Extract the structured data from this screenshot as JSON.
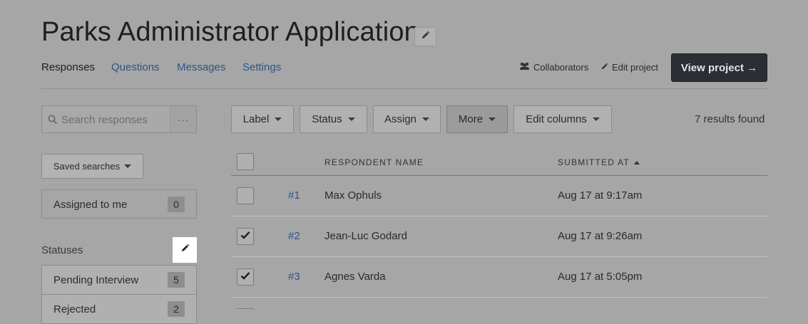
{
  "header": {
    "title": "Parks Administrator Application",
    "tabs": [
      {
        "label": "Responses",
        "active": true
      },
      {
        "label": "Questions",
        "active": false
      },
      {
        "label": "Messages",
        "active": false
      },
      {
        "label": "Settings",
        "active": false
      }
    ],
    "collaborators_label": "Collaborators",
    "edit_project_label": "Edit project",
    "view_project_label": "View project →"
  },
  "sidebar": {
    "search_placeholder": "Search responses",
    "search_more": "···",
    "saved_searches_label": "Saved searches",
    "assigned": {
      "label": "Assigned to me",
      "count": "0"
    },
    "statuses_title": "Statuses",
    "statuses": [
      {
        "label": "Pending Interview",
        "count": "5"
      },
      {
        "label": "Rejected",
        "count": "2"
      }
    ]
  },
  "toolbar": {
    "buttons": [
      {
        "label": "Label"
      },
      {
        "label": "Status"
      },
      {
        "label": "Assign"
      },
      {
        "label": "More",
        "pressed": true
      },
      {
        "label": "Edit columns"
      }
    ],
    "results_text": "7 results found"
  },
  "table": {
    "columns": [
      "RESPONDENT NAME",
      "SUBMITTED AT"
    ],
    "sorted_column": "SUBMITTED AT",
    "sort_direction": "ascending",
    "rows": [
      {
        "id": "#1",
        "name": "Max Ophuls",
        "submitted": "Aug 17 at 9:17am",
        "checked": false
      },
      {
        "id": "#2",
        "name": "Jean-Luc Godard",
        "submitted": "Aug 17 at 9:26am",
        "checked": true
      },
      {
        "id": "#3",
        "name": "Agnes Varda",
        "submitted": "Aug 17 at 5:05pm",
        "checked": true
      }
    ]
  },
  "colors": {
    "overlay_background": "#a6a6a6",
    "link": "#2a5687",
    "primary_button": "#2b2e34",
    "highlight": "#ffffff"
  },
  "icons": {
    "title_edit": "pencil-icon",
    "collaborators": "users-icon",
    "edit_project": "pencil-icon",
    "search": "search-icon",
    "statuses_edit": "pencil-icon",
    "checkbox_checked": "check-icon"
  }
}
